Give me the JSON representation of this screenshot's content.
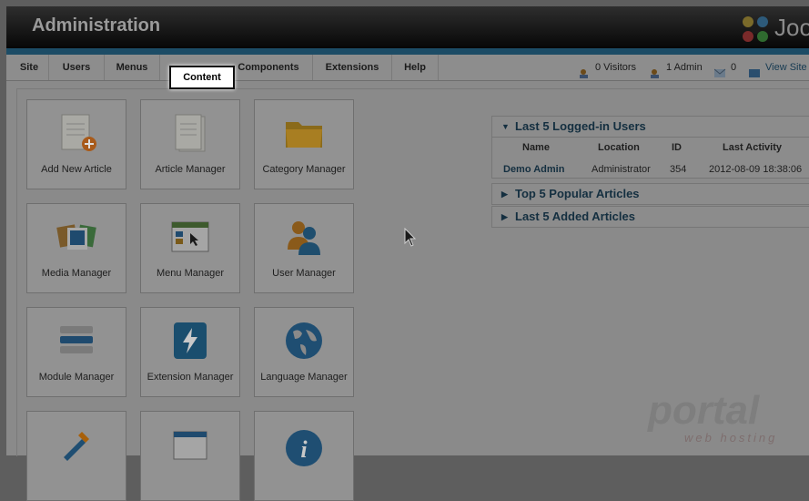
{
  "header": {
    "title": "Administration",
    "logo_text": "Joo"
  },
  "menu": {
    "items": [
      "Site",
      "Users",
      "Menus",
      "Content",
      "Components",
      "Extensions",
      "Help"
    ],
    "highlighted": "Content"
  },
  "status": {
    "visitors": "0 Visitors",
    "admins": "1 Admin",
    "messages": "0",
    "view_site": "View Site"
  },
  "cards": [
    {
      "label": "Add New Article",
      "icon": "add-article-icon"
    },
    {
      "label": "Article Manager",
      "icon": "article-icon"
    },
    {
      "label": "Category Manager",
      "icon": "folder-icon"
    },
    {
      "label": "Media Manager",
      "icon": "media-icon"
    },
    {
      "label": "Menu Manager",
      "icon": "menu-icon"
    },
    {
      "label": "User Manager",
      "icon": "users-icon"
    },
    {
      "label": "Module Manager",
      "icon": "module-icon"
    },
    {
      "label": "Extension Manager",
      "icon": "extension-icon"
    },
    {
      "label": "Language Manager",
      "icon": "globe-icon"
    },
    {
      "label": "",
      "icon": "tools-icon"
    },
    {
      "label": "",
      "icon": "template-icon"
    },
    {
      "label": "",
      "icon": "info-icon"
    }
  ],
  "modules": {
    "logged_in": {
      "title": "Last 5 Logged-in Users",
      "columns": [
        "Name",
        "Location",
        "ID",
        "Last Activity"
      ],
      "rows": [
        [
          "Demo Admin",
          "Administrator",
          "354",
          "2012-08-09 18:38:06"
        ]
      ]
    },
    "popular": {
      "title": "Top 5 Popular Articles"
    },
    "added": {
      "title": "Last 5 Added Articles"
    }
  },
  "watermark": {
    "main": "portal",
    "sub": "web hosting"
  },
  "colors": {
    "accent": "#1c4c66",
    "link": "#142f40"
  }
}
